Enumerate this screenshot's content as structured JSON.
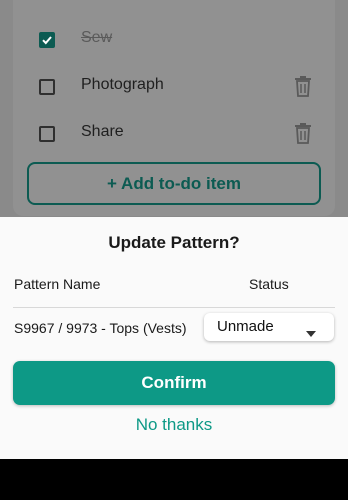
{
  "background": {
    "todos": [
      {
        "label": "Sew",
        "checked": true
      },
      {
        "label": "Photograph",
        "checked": false
      },
      {
        "label": "Share",
        "checked": false
      }
    ],
    "add_button_label": "+ Add to-do item"
  },
  "dialog": {
    "title": "Update Pattern?",
    "col_name": "Pattern Name",
    "col_status": "Status",
    "pattern_name": "S9967 / 9973 - Tops (Vests)",
    "status_value": "Unmade",
    "confirm_label": "Confirm",
    "decline_label": "No thanks"
  },
  "colors": {
    "accent": "#0d9986",
    "accent_dark": "#0c5b52",
    "scrim": "#8a8a8a",
    "sheet": "#fafafa"
  },
  "icons": [
    "checkbox-checked-icon",
    "checkbox-icon",
    "trash-icon",
    "dropdown-caret-icon"
  ]
}
